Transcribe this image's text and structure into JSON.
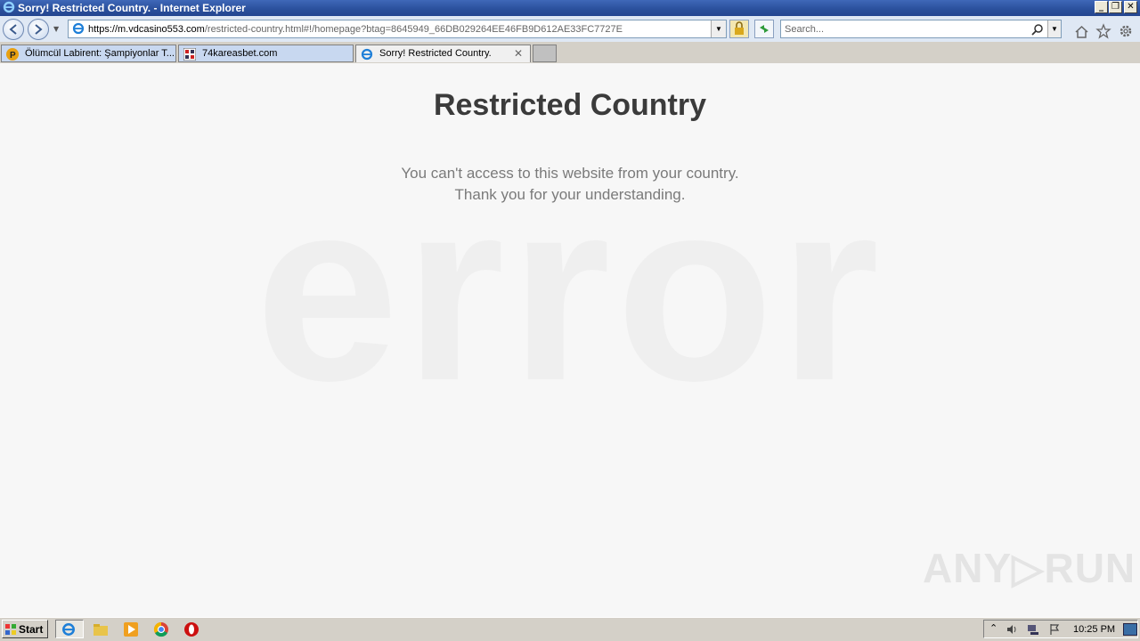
{
  "window": {
    "title": "Sorry! Restricted Country. - Internet Explorer",
    "minimize_label": "_",
    "restore_label": "❐",
    "close_label": "✕"
  },
  "addressbar": {
    "url_host": "https://m.vdcasino553.com",
    "url_path": "/restricted-country.html#!/homepage?btag=8645949_66DB029264EE46FB9D612AE33FC7727E"
  },
  "search": {
    "placeholder": "Search..."
  },
  "tabs": [
    {
      "label": "Ölümcül Labirent: Şampiyonlar T..."
    },
    {
      "label": "74kareasbet.com"
    },
    {
      "label": "Sorry! Restricted Country.",
      "close": "✕"
    }
  ],
  "page": {
    "heading": "Restricted Country",
    "message_line1": "You can't access to this website from your country.",
    "message_line2": "Thank you for your understanding.",
    "background_word": "error"
  },
  "watermark": "ANY▷RUN",
  "taskbar": {
    "start_label": "Start",
    "clock": "10:25 PM"
  },
  "colors": {
    "titlebar": "#2a4f9b",
    "heading": "#3b3b3b",
    "message": "#7a7a7a",
    "background": "#f7f7f7"
  }
}
